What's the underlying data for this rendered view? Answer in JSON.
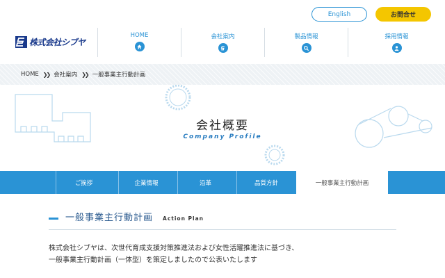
{
  "header": {
    "logo_text": "株式会社シブヤ",
    "english_label": "English",
    "contact_label": "お問合せ"
  },
  "gnav": [
    {
      "label": "HOME",
      "icon": "home-icon"
    },
    {
      "label": "会社案内",
      "icon": "company-icon"
    },
    {
      "label": "製品情報",
      "icon": "search-icon"
    },
    {
      "label": "採用情報",
      "icon": "person-icon"
    }
  ],
  "breadcrumb": [
    "HOME",
    "会社案内",
    "一般事業主行動計画"
  ],
  "hero": {
    "title": "会社概要",
    "subtitle": "Company Profile"
  },
  "subnav": [
    {
      "label": "ご挨拶",
      "active": false
    },
    {
      "label": "企業情報",
      "active": false
    },
    {
      "label": "沿革",
      "active": false
    },
    {
      "label": "品質方針",
      "active": false
    },
    {
      "label": "一般事業主行動計画",
      "active": true
    }
  ],
  "section": {
    "title": "一般事業主行動計画",
    "title_en": "Action Plan"
  },
  "body": {
    "line1": "株式会社シブヤは、次世代育成支援対策推進法および女性活躍推進法に基づき、",
    "line2": "一般事業主行動計画（一体型）を策定しましたので公表いたします"
  },
  "colors": {
    "brand_blue": "#2a93d5",
    "logo_navy": "#1a3a8c",
    "contact_yellow": "#f4c600"
  }
}
